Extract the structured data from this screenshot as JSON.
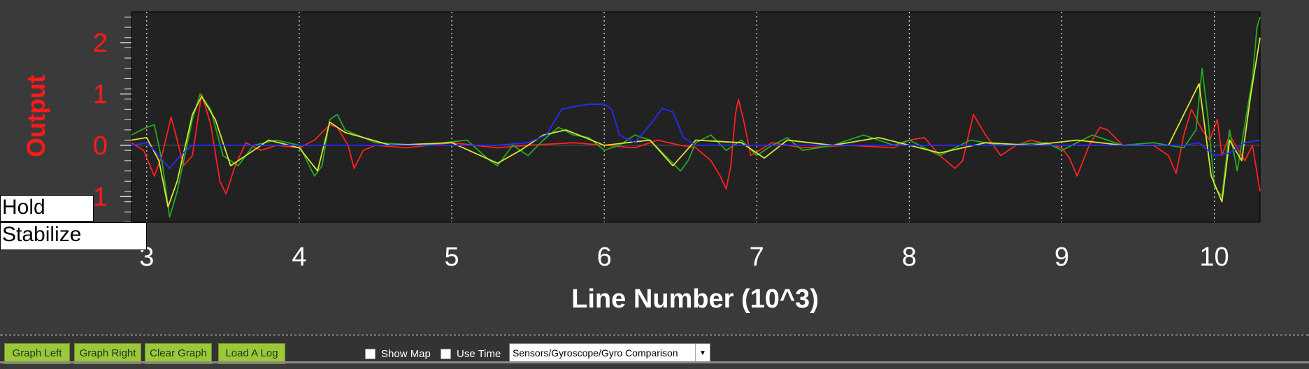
{
  "chart_data": {
    "type": "line",
    "title": "",
    "xlabel": "Line Number (10^3)",
    "ylabel": "Output",
    "xlim": [
      2.9,
      10.3
    ],
    "ylim": [
      -1.5,
      2.6
    ],
    "x_ticks": [
      3,
      4,
      5,
      6,
      7,
      8,
      9,
      10
    ],
    "y_ticks": [
      2,
      1,
      0,
      -1
    ],
    "grid": "vertical dotted",
    "series": [
      {
        "color": "#ff2020",
        "points": [
          [
            2.9,
            0.05
          ],
          [
            2.98,
            -0.1
          ],
          [
            3.05,
            -0.6
          ],
          [
            3.1,
            -0.2
          ],
          [
            3.16,
            0.55
          ],
          [
            3.2,
            0.1
          ],
          [
            3.24,
            -0.4
          ],
          [
            3.3,
            -0.2
          ],
          [
            3.36,
            1.0
          ],
          [
            3.42,
            0.4
          ],
          [
            3.48,
            -0.7
          ],
          [
            3.52,
            -0.95
          ],
          [
            3.58,
            -0.4
          ],
          [
            3.65,
            0.05
          ],
          [
            3.75,
            -0.1
          ],
          [
            3.85,
            0.0
          ],
          [
            4.0,
            -0.05
          ],
          [
            4.1,
            0.1
          ],
          [
            4.2,
            0.4
          ],
          [
            4.25,
            0.35
          ],
          [
            4.32,
            0.0
          ],
          [
            4.36,
            -0.45
          ],
          [
            4.42,
            -0.1
          ],
          [
            4.5,
            0.0
          ],
          [
            4.7,
            -0.05
          ],
          [
            5.0,
            0.05
          ],
          [
            5.3,
            -0.05
          ],
          [
            5.5,
            0.0
          ],
          [
            5.8,
            0.05
          ],
          [
            6.0,
            0.0
          ],
          [
            6.2,
            -0.05
          ],
          [
            6.35,
            0.1
          ],
          [
            6.5,
            0.0
          ],
          [
            6.6,
            -0.05
          ],
          [
            6.7,
            -0.3
          ],
          [
            6.76,
            -0.6
          ],
          [
            6.8,
            -0.85
          ],
          [
            6.83,
            -0.4
          ],
          [
            6.86,
            0.6
          ],
          [
            6.88,
            0.9
          ],
          [
            6.92,
            0.4
          ],
          [
            6.96,
            -0.2
          ],
          [
            7.1,
            0.05
          ],
          [
            7.3,
            -0.05
          ],
          [
            7.6,
            0.0
          ],
          [
            7.9,
            -0.05
          ],
          [
            8.0,
            0.1
          ],
          [
            8.1,
            0.15
          ],
          [
            8.2,
            -0.2
          ],
          [
            8.3,
            -0.45
          ],
          [
            8.35,
            -0.3
          ],
          [
            8.42,
            0.6
          ],
          [
            8.5,
            0.2
          ],
          [
            8.6,
            -0.2
          ],
          [
            8.7,
            0.0
          ],
          [
            8.8,
            0.1
          ],
          [
            9.0,
            -0.05
          ],
          [
            9.05,
            -0.25
          ],
          [
            9.1,
            -0.6
          ],
          [
            9.18,
            0.0
          ],
          [
            9.25,
            0.35
          ],
          [
            9.3,
            0.3
          ],
          [
            9.4,
            0.0
          ],
          [
            9.6,
            0.0
          ],
          [
            9.7,
            -0.2
          ],
          [
            9.75,
            -0.55
          ],
          [
            9.8,
            0.2
          ],
          [
            9.85,
            0.7
          ],
          [
            9.92,
            0.3
          ],
          [
            9.97,
            0.1
          ],
          [
            10.02,
            0.5
          ],
          [
            10.05,
            -0.2
          ],
          [
            10.1,
            0.2
          ],
          [
            10.2,
            -0.3
          ],
          [
            10.25,
            0.0
          ],
          [
            10.3,
            -0.9
          ]
        ]
      },
      {
        "color": "#22aa22",
        "points": [
          [
            2.9,
            0.2
          ],
          [
            3.0,
            0.35
          ],
          [
            3.05,
            0.4
          ],
          [
            3.1,
            -0.3
          ],
          [
            3.15,
            -1.4
          ],
          [
            3.2,
            -0.9
          ],
          [
            3.3,
            0.5
          ],
          [
            3.35,
            1.0
          ],
          [
            3.42,
            0.7
          ],
          [
            3.5,
            -0.2
          ],
          [
            3.6,
            -0.4
          ],
          [
            3.7,
            0.0
          ],
          [
            3.85,
            0.1
          ],
          [
            4.0,
            0.0
          ],
          [
            4.1,
            -0.6
          ],
          [
            4.15,
            -0.4
          ],
          [
            4.2,
            0.5
          ],
          [
            4.25,
            0.6
          ],
          [
            4.3,
            0.3
          ],
          [
            4.5,
            0.05
          ],
          [
            4.8,
            0.0
          ],
          [
            5.1,
            0.1
          ],
          [
            5.25,
            -0.3
          ],
          [
            5.3,
            -0.4
          ],
          [
            5.4,
            0.0
          ],
          [
            5.5,
            -0.2
          ],
          [
            5.6,
            0.1
          ],
          [
            5.7,
            0.35
          ],
          [
            5.8,
            0.2
          ],
          [
            5.9,
            0.15
          ],
          [
            6.0,
            -0.1
          ],
          [
            6.1,
            0.0
          ],
          [
            6.2,
            0.2
          ],
          [
            6.3,
            0.1
          ],
          [
            6.4,
            -0.2
          ],
          [
            6.5,
            -0.5
          ],
          [
            6.55,
            -0.3
          ],
          [
            6.6,
            0.05
          ],
          [
            6.7,
            0.2
          ],
          [
            6.8,
            -0.1
          ],
          [
            6.9,
            0.1
          ],
          [
            7.0,
            -0.2
          ],
          [
            7.1,
            0.0
          ],
          [
            7.2,
            0.15
          ],
          [
            7.3,
            -0.1
          ],
          [
            7.5,
            0.0
          ],
          [
            7.7,
            0.2
          ],
          [
            7.9,
            0.0
          ],
          [
            8.0,
            0.1
          ],
          [
            8.2,
            -0.2
          ],
          [
            8.4,
            0.1
          ],
          [
            8.6,
            0.0
          ],
          [
            8.9,
            0.05
          ],
          [
            9.0,
            -0.1
          ],
          [
            9.2,
            0.2
          ],
          [
            9.4,
            0.0
          ],
          [
            9.6,
            0.05
          ],
          [
            9.8,
            -0.05
          ],
          [
            9.88,
            0.3
          ],
          [
            9.92,
            1.5
          ],
          [
            9.96,
            0.5
          ],
          [
            10.0,
            -0.8
          ],
          [
            10.05,
            -1.0
          ],
          [
            10.1,
            0.3
          ],
          [
            10.15,
            -0.5
          ],
          [
            10.2,
            0.4
          ],
          [
            10.25,
            1.3
          ],
          [
            10.28,
            2.3
          ],
          [
            10.3,
            2.5
          ]
        ]
      },
      {
        "color": "#d8e630",
        "points": [
          [
            2.9,
            0.1
          ],
          [
            3.0,
            0.15
          ],
          [
            3.08,
            -0.3
          ],
          [
            3.14,
            -1.2
          ],
          [
            3.2,
            -0.7
          ],
          [
            3.3,
            0.6
          ],
          [
            3.36,
            0.95
          ],
          [
            3.45,
            0.5
          ],
          [
            3.55,
            -0.4
          ],
          [
            3.65,
            -0.2
          ],
          [
            3.8,
            0.1
          ],
          [
            4.0,
            -0.05
          ],
          [
            4.12,
            -0.5
          ],
          [
            4.2,
            0.45
          ],
          [
            4.3,
            0.25
          ],
          [
            4.6,
            0.0
          ],
          [
            5.0,
            0.05
          ],
          [
            5.3,
            -0.35
          ],
          [
            5.45,
            -0.1
          ],
          [
            5.6,
            0.2
          ],
          [
            5.75,
            0.3
          ],
          [
            6.0,
            0.0
          ],
          [
            6.3,
            0.1
          ],
          [
            6.45,
            -0.4
          ],
          [
            6.6,
            0.1
          ],
          [
            6.9,
            0.05
          ],
          [
            7.05,
            -0.25
          ],
          [
            7.2,
            0.1
          ],
          [
            7.5,
            0.0
          ],
          [
            7.8,
            0.15
          ],
          [
            8.0,
            0.0
          ],
          [
            8.2,
            -0.15
          ],
          [
            8.5,
            0.05
          ],
          [
            8.8,
            0.0
          ],
          [
            9.1,
            0.1
          ],
          [
            9.4,
            0.0
          ],
          [
            9.7,
            0.0
          ],
          [
            9.9,
            1.2
          ],
          [
            9.98,
            -0.6
          ],
          [
            10.05,
            -1.1
          ],
          [
            10.1,
            0.1
          ],
          [
            10.18,
            -0.3
          ],
          [
            10.24,
            1.0
          ],
          [
            10.3,
            2.1
          ]
        ]
      },
      {
        "color": "#2a2aff",
        "points": [
          [
            2.9,
            0.0
          ],
          [
            3.0,
            0.05
          ],
          [
            3.05,
            -0.1
          ],
          [
            3.15,
            -0.45
          ],
          [
            3.22,
            -0.2
          ],
          [
            3.3,
            0.0
          ],
          [
            3.5,
            0.0
          ],
          [
            4.0,
            0.0
          ],
          [
            4.5,
            0.0
          ],
          [
            5.0,
            0.0
          ],
          [
            5.3,
            0.0
          ],
          [
            5.5,
            0.05
          ],
          [
            5.62,
            0.2
          ],
          [
            5.72,
            0.7
          ],
          [
            5.8,
            0.75
          ],
          [
            5.9,
            0.8
          ],
          [
            6.0,
            0.8
          ],
          [
            6.05,
            0.7
          ],
          [
            6.1,
            0.2
          ],
          [
            6.2,
            0.05
          ],
          [
            6.3,
            0.4
          ],
          [
            6.38,
            0.72
          ],
          [
            6.45,
            0.65
          ],
          [
            6.52,
            0.15
          ],
          [
            6.6,
            0.0
          ],
          [
            7.0,
            0.0
          ],
          [
            7.5,
            0.0
          ],
          [
            8.0,
            0.0
          ],
          [
            8.5,
            0.0
          ],
          [
            9.0,
            0.0
          ],
          [
            9.5,
            0.0
          ],
          [
            9.8,
            0.0
          ],
          [
            9.9,
            0.05
          ],
          [
            10.0,
            -0.2
          ],
          [
            10.1,
            -0.15
          ],
          [
            10.2,
            0.05
          ],
          [
            10.3,
            0.1
          ]
        ]
      }
    ]
  },
  "overlays": {
    "hold_label": "Hold",
    "stabilize_label": "Stabilize"
  },
  "toolbar": {
    "graph_left": "Graph Left",
    "graph_right": "Graph Right",
    "clear_graph": "Clear Graph",
    "load_log": "Load A Log",
    "show_map": "Show Map",
    "use_time": "Use Time",
    "graph_select_value": "Sensors/Gyroscope/Gyro Comparison"
  },
  "colors": {
    "plot_background": "#222222",
    "panel_background": "#3a3a3a",
    "axis_label_color": "#ff1a1a",
    "tick_label_color": "#ffffff",
    "button_green": "#9bc83a"
  }
}
